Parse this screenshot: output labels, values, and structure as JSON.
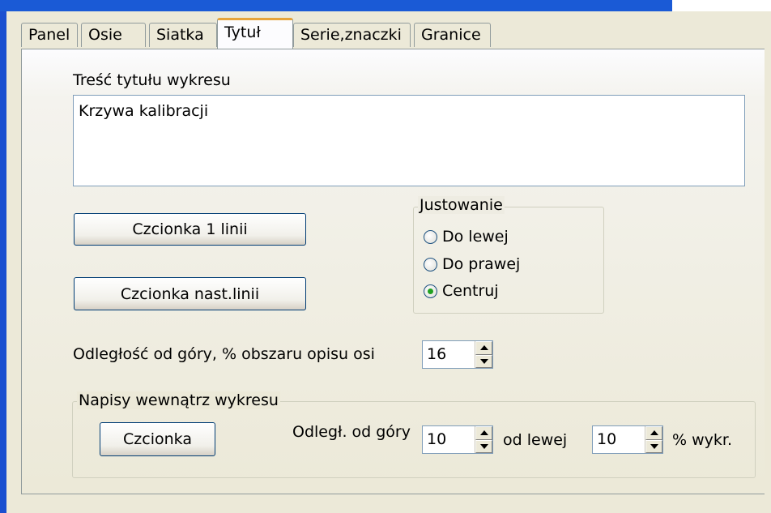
{
  "tabs": [
    {
      "label": "Panel"
    },
    {
      "label": "Osie"
    },
    {
      "label": "Siatka"
    },
    {
      "label": "Tytuł"
    },
    {
      "label": "Serie,znaczki"
    },
    {
      "label": "Granice"
    }
  ],
  "active_tab": "Tytuł",
  "title_section": {
    "label": "Treść tytułu wykresu",
    "value": "Krzywa kalibracji"
  },
  "buttons": {
    "font_first_line": "Czcionka 1  linii",
    "font_next_line": "Czcionka nast.linii"
  },
  "alignment": {
    "label": "Justowanie",
    "options": [
      "Do lewej",
      "Do prawej",
      "Centruj"
    ],
    "selected": "Centruj"
  },
  "distance_top": {
    "label": "Odległość od góry, % obszaru opisu osi",
    "value": "16"
  },
  "inner_labels": {
    "group_label": "Napisy wewnątrz wykresu",
    "font_button": "Czcionka",
    "top_label": "Odległ. od góry",
    "top_value": "10",
    "left_label": "od lewej",
    "left_value": "10",
    "unit_label": "% wykr."
  }
}
